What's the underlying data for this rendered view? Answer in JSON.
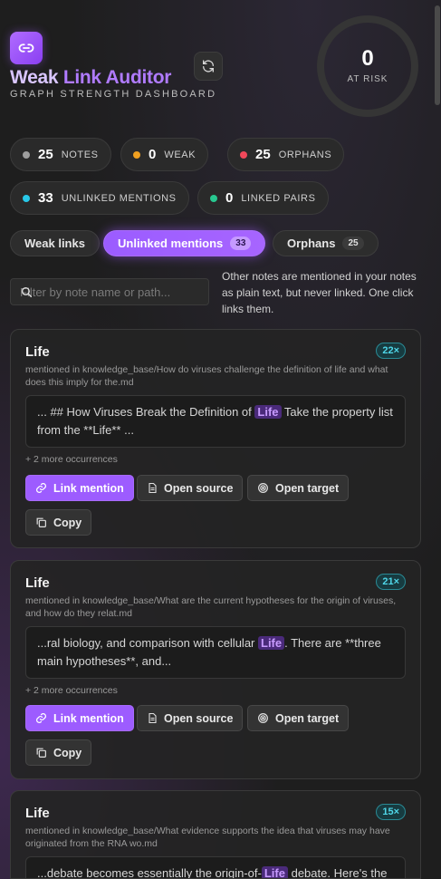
{
  "app": {
    "title_weak": "Weak",
    "title_link": "Link Auditor",
    "subtitle": "GRAPH STRENGTH DASHBOARD",
    "risk_value": "0",
    "risk_label": "AT RISK"
  },
  "stats": [
    {
      "value": "25",
      "label": "NOTES",
      "color": "#9e9e9e"
    },
    {
      "value": "0",
      "label": "WEAK",
      "color": "#f0a020"
    },
    {
      "value": "25",
      "label": "ORPHANS",
      "color": "#f0485a"
    },
    {
      "value": "33",
      "label": "UNLINKED MENTIONS",
      "color": "#28c8e8"
    },
    {
      "value": "0",
      "label": "LINKED PAIRS",
      "color": "#28c890"
    }
  ],
  "tabs": [
    {
      "label": "Weak links",
      "badge": ""
    },
    {
      "label": "Unlinked mentions",
      "badge": "33"
    },
    {
      "label": "Orphans",
      "badge": "25"
    }
  ],
  "filter": {
    "placeholder": "Filter by note name or path..."
  },
  "help_text": "Other notes are mentioned in your notes as plain text, but never linked. One click links them.",
  "actions": {
    "link": "Link mention",
    "source": "Open source",
    "target": "Open target",
    "copy": "Copy"
  },
  "cards": [
    {
      "title": "Life",
      "count": "22×",
      "path": "mentioned in knowledge_base/How do viruses challenge the definition of life and what does this imply for the.md",
      "before": "... ## How Viruses Break the Definition of ",
      "match": "Life",
      "after": " Take the property list from the **Life** ...",
      "more": "+ 2 more occurrences"
    },
    {
      "title": "Life",
      "count": "21×",
      "path": "mentioned in knowledge_base/What are the current hypotheses for the origin of viruses, and how do they relat.md",
      "before": "...ral biology, and comparison with cellular ",
      "match": "Life",
      "after": ". There are **three main hypotheses**, and...",
      "more": "+ 2 more occurrences"
    },
    {
      "title": "Life",
      "count": "15×",
      "path": "mentioned in knowledge_base/What evidence supports the idea that viruses may have originated from the RNA wo.md",
      "before": "...debate becomes essentially the origin-of-",
      "match": "Life",
      "after": " debate. Here's the",
      "more": ""
    }
  ]
}
